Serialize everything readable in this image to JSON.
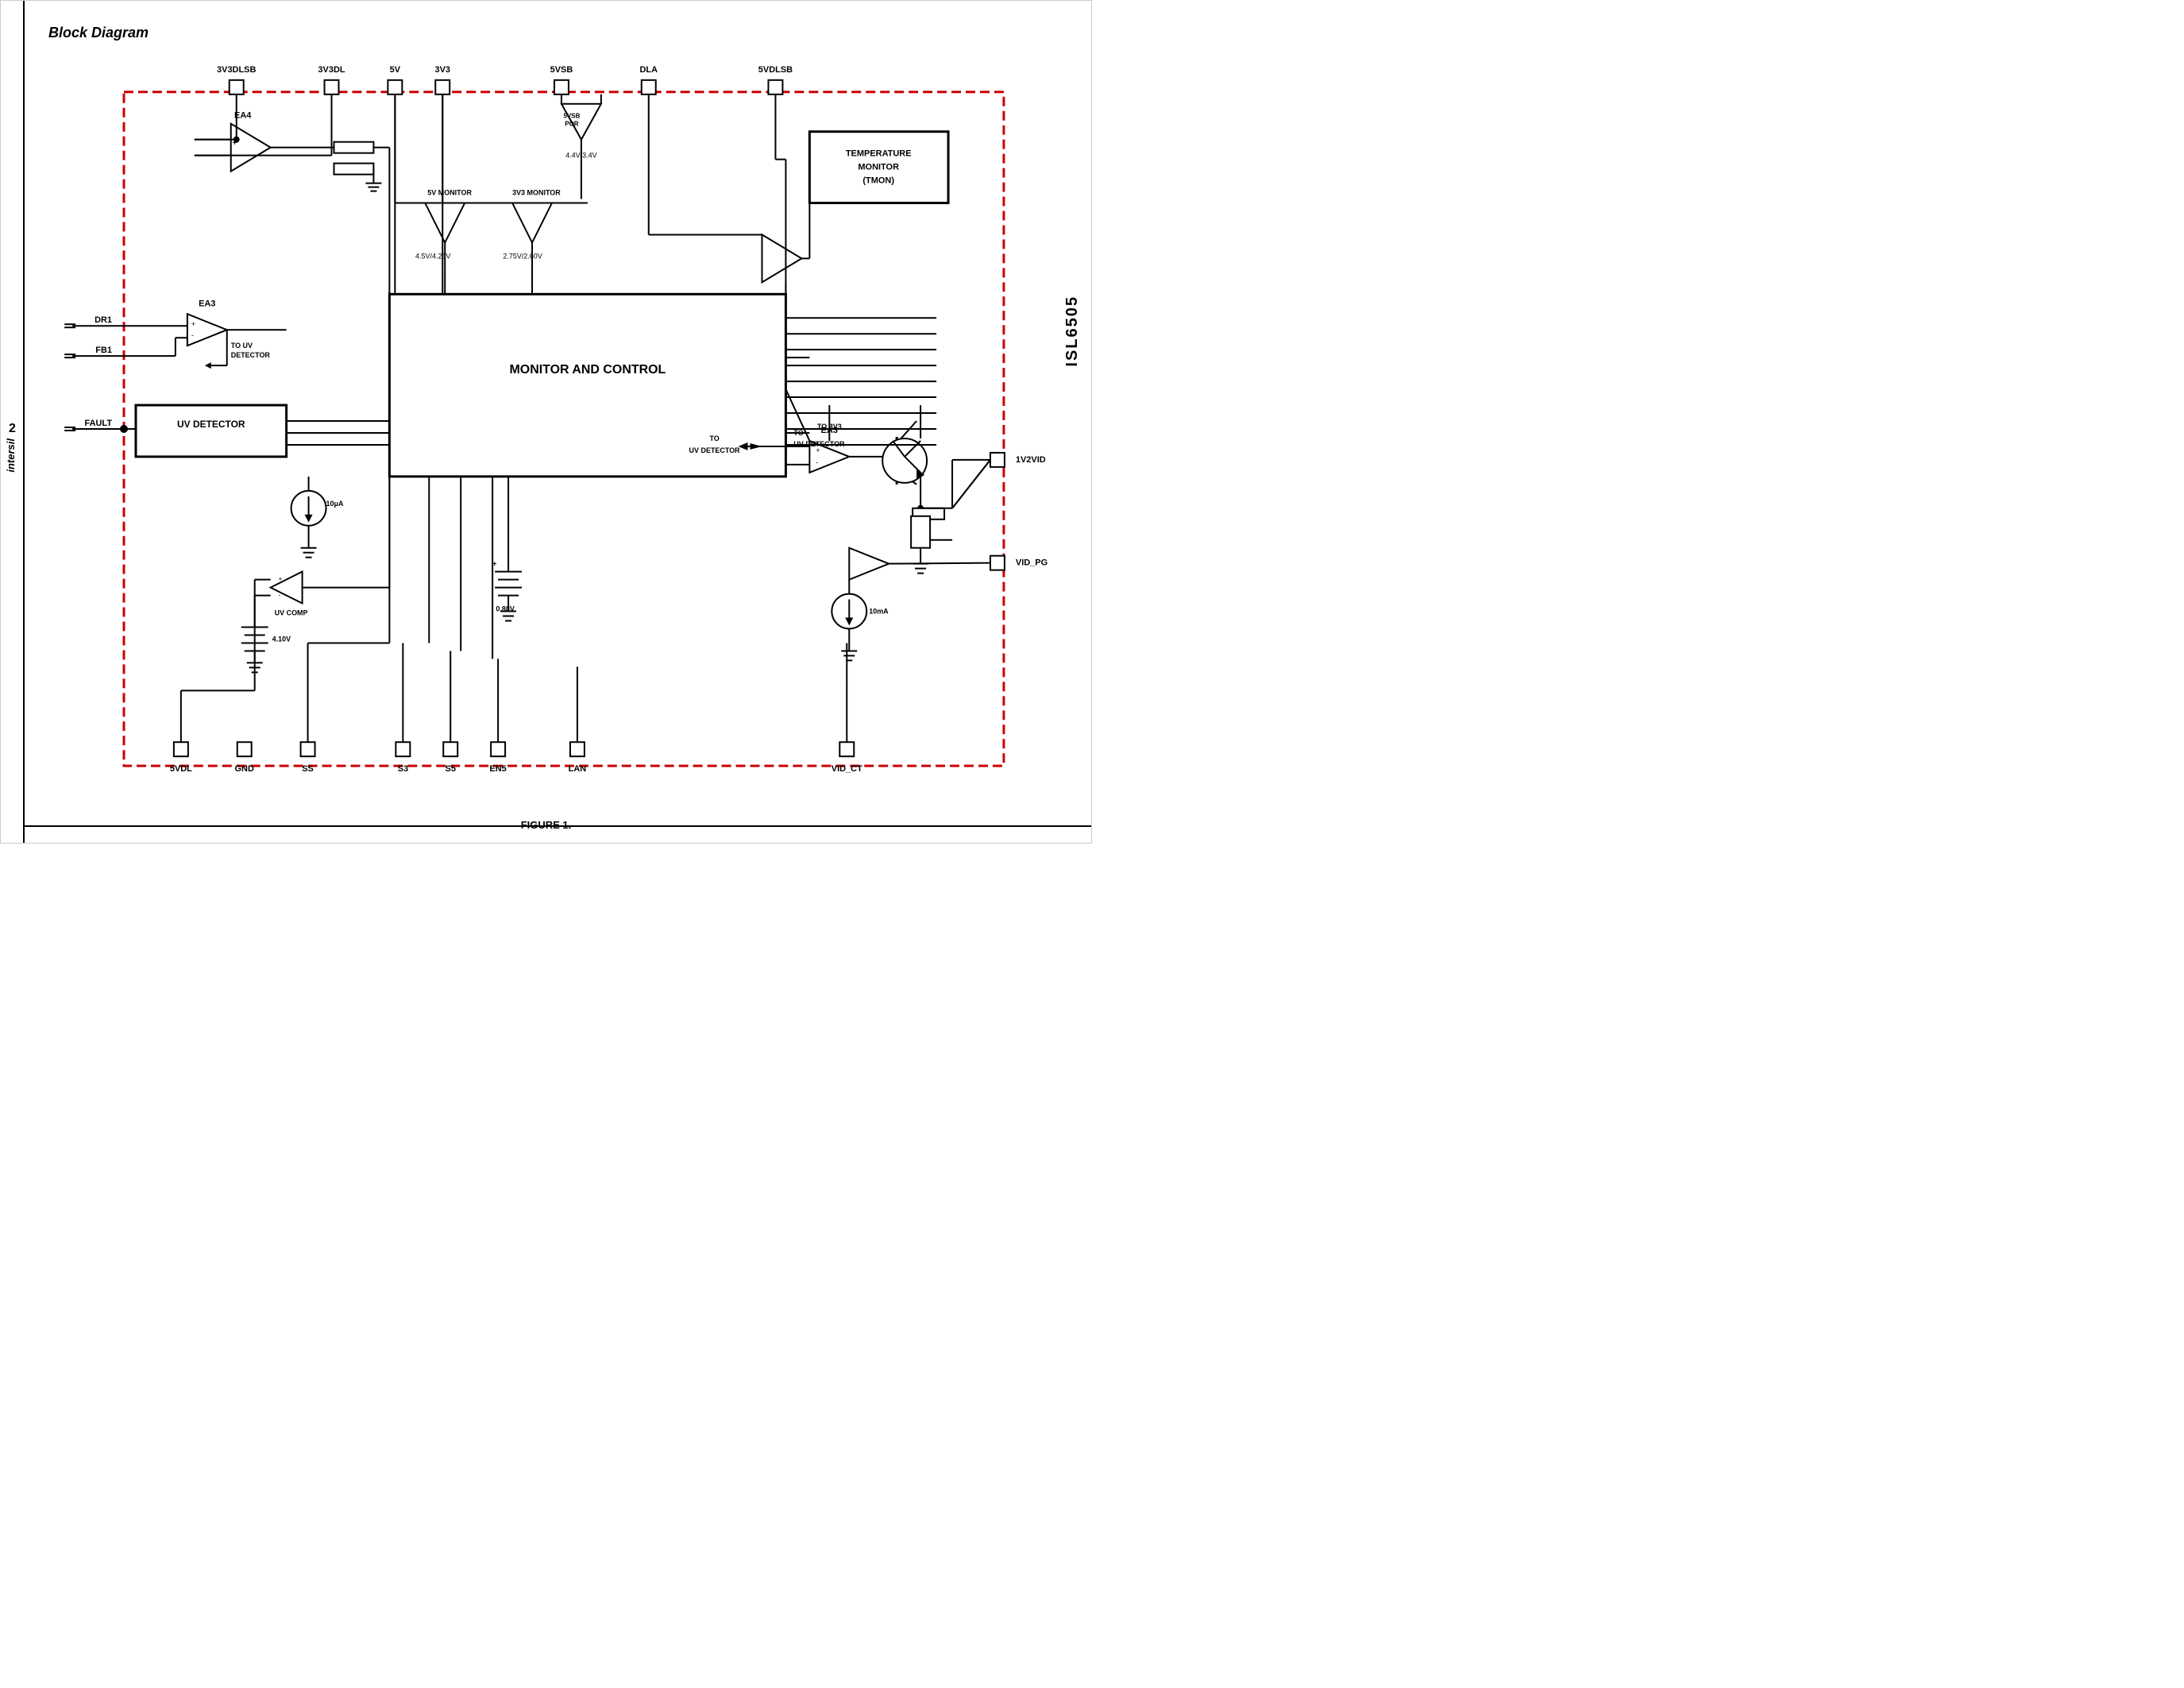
{
  "page": {
    "title": "Block Diagram",
    "page_number": "2",
    "chip_name": "ISL6505",
    "figure_caption": "FIGURE 1.",
    "company": "intersil"
  },
  "diagram": {
    "main_block": "MONITOR AND CONTROL",
    "uv_detector": "UV DETECTOR",
    "temp_monitor": "TEMPERATURE\nMONITOR\n(TMON)",
    "uv_comp": "UV COMP",
    "ea3_label1": "EA3",
    "ea3_label2": "EA3",
    "ea4_label": "EA4"
  },
  "pins": {
    "top": [
      "3V3DLSB",
      "3V3DL",
      "5V",
      "3V3",
      "5VSB",
      "DLA",
      "5VDLSB"
    ],
    "bottom": [
      "5VDL",
      "GND",
      "SS",
      "S3",
      "S5",
      "EN5",
      "LAN",
      "VID_CT"
    ],
    "left": [
      "DR1",
      "FB1",
      "FAULT"
    ],
    "right": [
      "1V2VID",
      "VID_PG"
    ]
  },
  "voltage_labels": {
    "v5vsb_por": "5VSB POR",
    "v44_34": "4.4V/3.4V",
    "v5_monitor": "5V MONITOR",
    "v45_425": "4.5V/4.25V",
    "v3v3_monitor": "3V3 MONITOR",
    "v275_260": "2.75V/2.60V",
    "v080": "0.80V",
    "v410": "4.10V",
    "to_uv_detector1": "TO UV\nDETECTOR",
    "to_uv_detector2": "TO\nUV DETECTOR",
    "to_3v3": "TO 3V3",
    "current_10ua": "10μA",
    "current_10ma": "10mA"
  }
}
